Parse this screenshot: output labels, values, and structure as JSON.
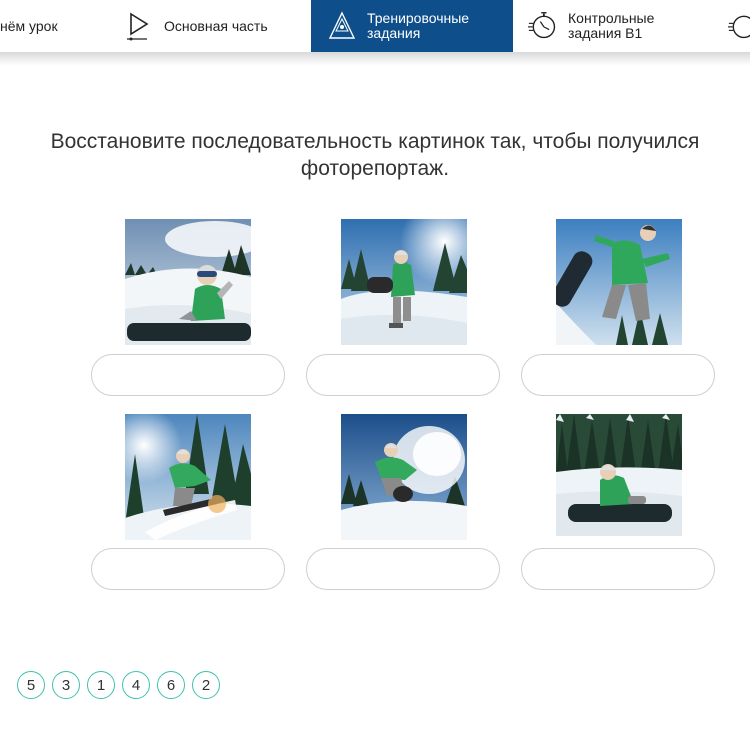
{
  "nav": {
    "items": [
      {
        "label": "нём урок",
        "icon": "review-icon",
        "active": false
      },
      {
        "label": "Основная часть",
        "icon": "play-icon",
        "active": false
      },
      {
        "label": "Тренировочные\nзадания",
        "icon": "triangle-icon",
        "active": true
      },
      {
        "label": "Контрольные\nзадания В1",
        "icon": "stopwatch-icon",
        "active": false
      },
      {
        "label": "",
        "icon": "stopwatch-icon",
        "active": false
      }
    ],
    "active_color": "#0e4f8b"
  },
  "task": {
    "instruction": "Восстановите последовательность картинок так, чтобы получился фоторепортаж."
  },
  "photos": [
    {
      "scene": "snowboarder-sitting-on-slope"
    },
    {
      "scene": "snowboarder-holding-board"
    },
    {
      "scene": "snowboarder-jumping"
    },
    {
      "scene": "snowboarder-riding-in-forest"
    },
    {
      "scene": "snowboarder-spraying-snow"
    },
    {
      "scene": "snowboarder-sitting-in-forest"
    }
  ],
  "answer_slots": [
    "",
    "",
    "",
    "",
    "",
    ""
  ],
  "options": [
    "5",
    "3",
    "1",
    "4",
    "6",
    "2"
  ],
  "colors": {
    "chip_border": "#3fc2b0",
    "slot_border": "#cfcfcf"
  }
}
